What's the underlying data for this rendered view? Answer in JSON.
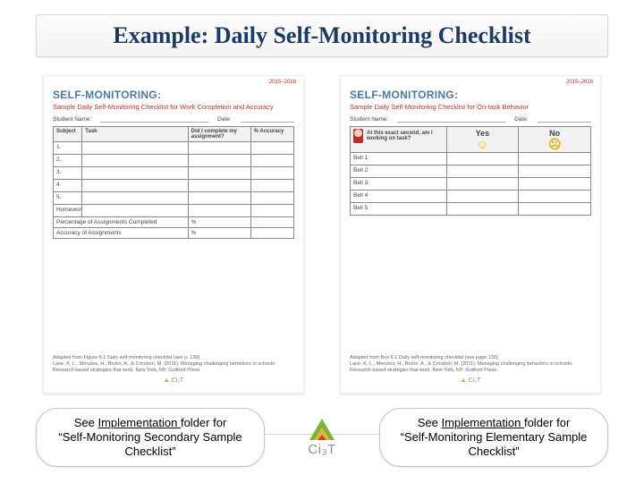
{
  "title": "Example: Daily Self-Monitoring Checklist",
  "year_range": "2015–2016",
  "doc_left": {
    "heading": "SELF-MONITORING:",
    "subtitle": "Sample Daily Self-Monitoring Checklist for Work Completion and Accuracy",
    "name_label": "Student Name:",
    "date_label": "Date:",
    "cols": {
      "c1": "Subject",
      "c2": "Task",
      "c3": "Did I complete my assignment?",
      "c4": "% Accuracy"
    },
    "rows": [
      "1.",
      "2.",
      "3.",
      "4.",
      "5.",
      "Homework"
    ],
    "footer_rows": {
      "r1": "Percentage of Assignments Completed",
      "r2": "Accuracy of Assignments",
      "pct": "%"
    },
    "credit1": "Adapted from Figure 6.1 Daily self-monitoring checklist (see p. 139)",
    "credit2": "Lane, K. L., Menzies, H., Bruhn, A., & Crnobori, M. (2011). Managing challenging behaviors in schools: Research-based strategies that work. New York, NY: Guilford Press."
  },
  "doc_right": {
    "heading": "SELF-MONITORING:",
    "subtitle": "Sample Daily Self-Monitoring Checklist for On-task Behavior",
    "name_label": "Student Name:",
    "date_label": "Date:",
    "prompt": "At this exact second, am I working on task?",
    "yes": "Yes",
    "no": "No",
    "bells": [
      "Bell 1",
      "Bell 2",
      "Bell 3",
      "Bell 4",
      "Bell 5"
    ],
    "credit1": "Adapted from Box 6.1 Daily self-monitoring checklist (see page 139)",
    "credit2": "Lane, K. L., Menzies, H., Bruhn, A., & Crnobori, M. (2011). Managing challenging behaviors in schools: Research-based strategies that work. New York, NY: Guilford Press."
  },
  "mini_brand": "Ci₃T",
  "callouts": {
    "left_pre": "See ",
    "left_link": "Implementation ",
    "left_mid": "folder for",
    "left_line2": "“Self-Monitoring Secondary Sample Checklist”",
    "right_pre": "See ",
    "right_link": "Implementation ",
    "right_mid": "folder for",
    "right_line2": "“Self-Monitoring Elementary Sample Checklist”"
  },
  "brand": "Ci₃T"
}
